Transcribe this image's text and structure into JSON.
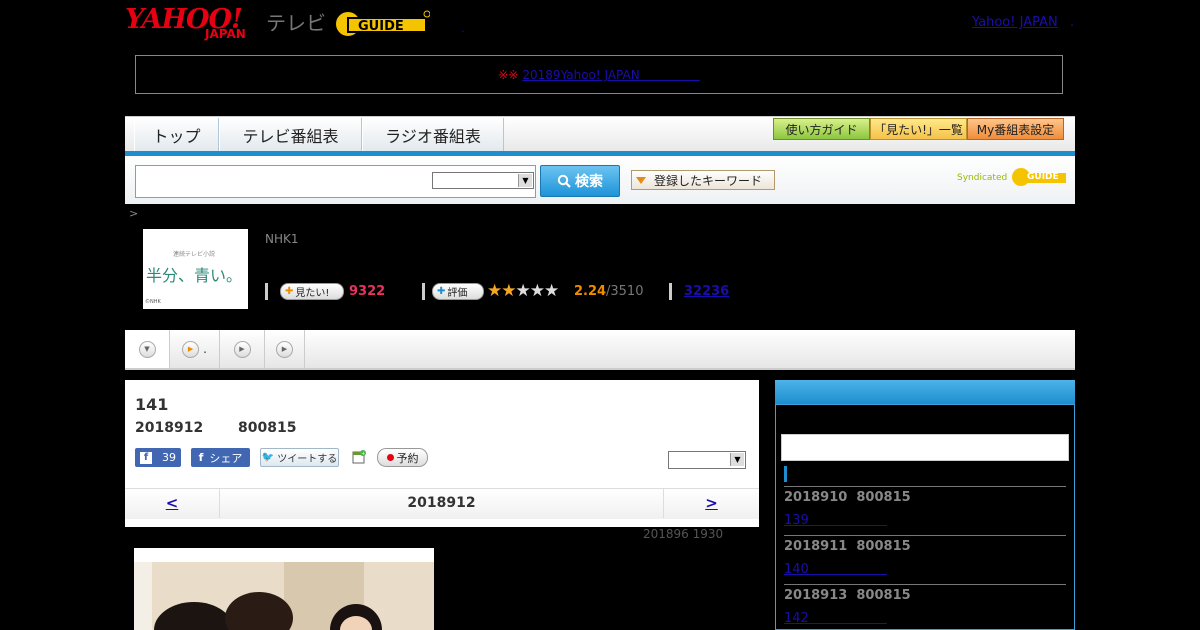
{
  "header": {
    "logo_yahoo": "YAHOO!",
    "logo_japan": "JAPAN",
    "logo_tv": "テレビ",
    "logo_gguide": "G GUIDE",
    "mid_dot": ".",
    "link_yahoo_japan": "Yahoo! JAPAN",
    "link_dot": "."
  },
  "notice": {
    "mark": "※※",
    "link": "20189Yahoo! JAPAN　　　　　"
  },
  "nav": {
    "tabs": [
      "トップ",
      "テレビ番組表",
      "ラジオ番組表"
    ],
    "guide": "使い方ガイド",
    "want_list": "「見たい!」一覧",
    "my_settings": "My番組表設定"
  },
  "search": {
    "button": "検索",
    "keyword_button": "登録したキーワード",
    "syndicated": "Syndicated",
    "gguide": "GUIDE"
  },
  "program": {
    "breadcrumb": ">",
    "thumb_small": "連続テレビ小説",
    "thumb_title": "半分、青い。",
    "thumb_credit": "©NHK",
    "channel": "NHK1",
    "want_button": "見たい!",
    "want_count": "9322",
    "rate_button": "評価",
    "rating_value": 2.24,
    "rating_text": "2.24",
    "rating_of": "/3510",
    "review_count": "32236"
  },
  "subnav": {
    "item2": "."
  },
  "episode": {
    "number": "141",
    "date": "2018912",
    "time": "800815",
    "fb_count": "39",
    "fb_share": "シェア",
    "tweet": "ツイートする",
    "reserve": "予約",
    "pager_prev": "<",
    "pager_title": "2018912",
    "pager_next": ">",
    "updated": "201896  1930"
  },
  "sidebar": {
    "items": [
      {
        "date": "2018910",
        "time": "800815",
        "link": "139　　　　　　"
      },
      {
        "date": "2018911",
        "time": "800815",
        "link": "140　　　　　　"
      },
      {
        "date": "2018913",
        "time": "800815",
        "link": "142　　　　　　"
      }
    ]
  },
  "colors": {
    "accent_blue": "#1d8fcf",
    "yahoo_red": "#e60012",
    "want_pink": "#e8325f",
    "rating_orange": "#f08c00"
  }
}
